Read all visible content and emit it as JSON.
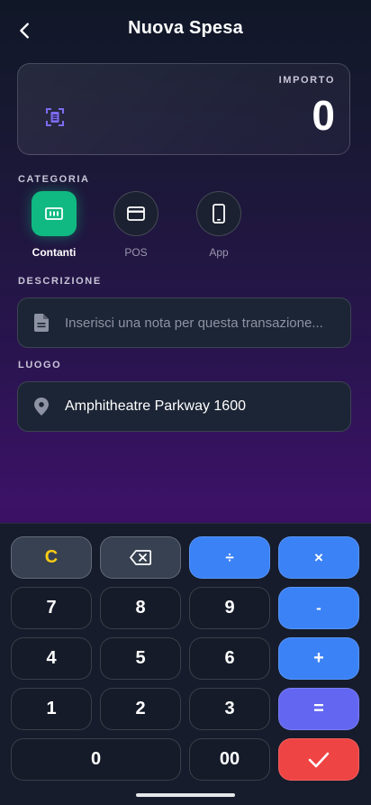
{
  "header": {
    "title": "Nuova Spesa",
    "back_icon": "chevron-left-icon"
  },
  "amount": {
    "label": "IMPORTO",
    "value": "0",
    "icon": "receipt-scan-icon"
  },
  "category": {
    "label": "CATEGORIA",
    "items": [
      {
        "label": "Contanti",
        "icon": "cash-icon",
        "selected": true
      },
      {
        "label": "POS",
        "icon": "credit-card-icon",
        "selected": false
      },
      {
        "label": "App",
        "icon": "smartphone-icon",
        "selected": false
      }
    ]
  },
  "description": {
    "label": "DESCRIZIONE",
    "placeholder": "Inserisci una nota per questa transazione...",
    "value": ""
  },
  "location": {
    "label": "LUOGO",
    "value": "Amphitheatre Parkway 1600"
  },
  "keypad": {
    "clear": "C",
    "backspace_icon": "backspace-icon",
    "divide": "÷",
    "multiply": "×",
    "minus": "-",
    "plus": "+",
    "equals": "=",
    "digits": {
      "d0": "0",
      "d1": "1",
      "d2": "2",
      "d3": "3",
      "d4": "4",
      "d5": "5",
      "d6": "6",
      "d7": "7",
      "d8": "8",
      "d9": "9",
      "d00": "00"
    },
    "confirm_icon": "checkmark-icon"
  },
  "colors": {
    "accent_green": "#10b981",
    "accent_blue": "#3b82f6",
    "accent_purple": "#6366f1",
    "accent_red": "#ef4444",
    "clear_yellow": "#facc15"
  }
}
